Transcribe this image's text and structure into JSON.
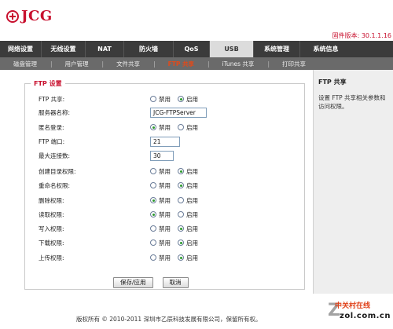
{
  "brand": {
    "logo_text": "JCG"
  },
  "firmware": "固件版本: 30.1.1.16",
  "nav": {
    "items": [
      {
        "label": "网络设置"
      },
      {
        "label": "无线设置"
      },
      {
        "label": "NAT"
      },
      {
        "label": "防火墙"
      },
      {
        "label": "QoS"
      },
      {
        "label": "USB",
        "active": true
      },
      {
        "label": "系统管理"
      },
      {
        "label": "系统信息"
      }
    ]
  },
  "subnav": {
    "items": [
      {
        "label": "磁盘管理"
      },
      {
        "label": "用户管理"
      },
      {
        "label": "文件共享"
      },
      {
        "label": "FTP 共享",
        "active": true
      },
      {
        "label": "iTunes 共享"
      },
      {
        "label": "打印共享"
      }
    ]
  },
  "form": {
    "legend": "FTP 设置",
    "option_disable": "禁用",
    "option_enable": "启用",
    "rows": [
      {
        "label": "FTP 共享:",
        "type": "radio",
        "value": "enable"
      },
      {
        "label": "服务器名称:",
        "type": "text",
        "value": "JCG-FTPServer"
      },
      {
        "label": "匿名登录:",
        "type": "radio",
        "value": "disable"
      },
      {
        "label": "FTP 端口:",
        "type": "text",
        "value": "21"
      },
      {
        "label": "最大连接数:",
        "type": "text",
        "value": "30"
      },
      {
        "label": "创建目录权限:",
        "type": "radio",
        "value": "enable"
      },
      {
        "label": "重命名权限:",
        "type": "radio",
        "value": "enable"
      },
      {
        "label": "删除权限:",
        "type": "radio",
        "value": "disable"
      },
      {
        "label": "读取权限:",
        "type": "radio",
        "value": "disable"
      },
      {
        "label": "写入权限:",
        "type": "radio",
        "value": "enable"
      },
      {
        "label": "下载权限:",
        "type": "radio",
        "value": "enable"
      },
      {
        "label": "上传权限:",
        "type": "radio",
        "value": "enable"
      }
    ],
    "save_label": "保存/应用",
    "cancel_label": "取消"
  },
  "help": {
    "title": "FTP 共享",
    "line1": "设置  FTP 共享相关参数和",
    "line2": "访问权限。"
  },
  "footer": {
    "copyright": "版权所有 © 2010-2011 深圳市乙辰科技发展有限公司，保留所有权。"
  },
  "watermark": {
    "line1": "中关村在线",
    "line2": "zol.com.cn"
  },
  "colors": {
    "accent": "#c8102e",
    "nav_bg": "#3b3b3b",
    "subnav_bg": "#6a6a6a",
    "subnav_active": "#e24a1a"
  }
}
